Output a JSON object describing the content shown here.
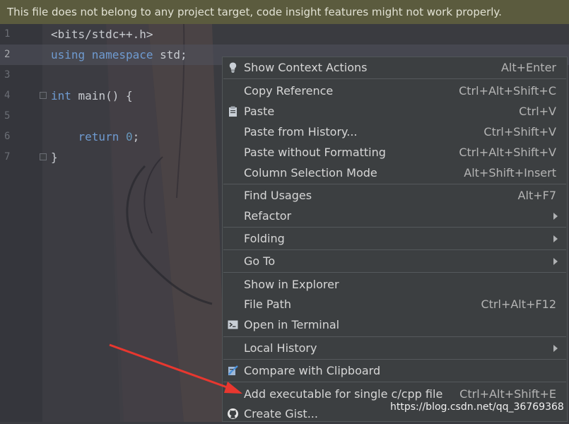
{
  "banner": {
    "text": "This file does not belong to any project target, code insight features might not work properly."
  },
  "editor": {
    "lines": [
      {
        "num": "1",
        "tokens": [
          {
            "t": "<bits/stdc++.h>",
            "c": "plain"
          }
        ]
      },
      {
        "num": "2",
        "tokens": [
          {
            "t": "using namespace",
            "c": "kw"
          },
          {
            "t": " std;",
            "c": "plain"
          }
        ]
      },
      {
        "num": "3",
        "tokens": []
      },
      {
        "num": "4",
        "tokens": [
          {
            "t": "int",
            "c": "kw"
          },
          {
            "t": " main() {",
            "c": "plain"
          }
        ]
      },
      {
        "num": "5",
        "tokens": []
      },
      {
        "num": "6",
        "tokens": [
          {
            "t": "    return",
            "c": "kw"
          },
          {
            "t": " ",
            "c": "plain"
          },
          {
            "t": "0",
            "c": "num"
          },
          {
            "t": ";",
            "c": "plain"
          }
        ]
      },
      {
        "num": "7",
        "tokens": [
          {
            "t": "}",
            "c": "plain"
          }
        ]
      }
    ],
    "current_line": "2"
  },
  "menu": {
    "items": [
      {
        "label": "Show Context Actions",
        "shortcut": "Alt+Enter",
        "icon": "bulb-icon"
      },
      {
        "label": "Copy Reference",
        "shortcut": "Ctrl+Alt+Shift+C"
      },
      {
        "label": "Paste",
        "shortcut": "Ctrl+V",
        "icon": "clipboard-icon"
      },
      {
        "label": "Paste from History...",
        "shortcut": "Ctrl+Shift+V"
      },
      {
        "label": "Paste without Formatting",
        "shortcut": "Ctrl+Alt+Shift+V"
      },
      {
        "label": "Column Selection Mode",
        "shortcut": "Alt+Shift+Insert"
      },
      {
        "label": "Find Usages",
        "shortcut": "Alt+F7"
      },
      {
        "label": "Refactor",
        "submenu": true
      },
      {
        "label": "Folding",
        "submenu": true
      },
      {
        "label": "Go To",
        "submenu": true
      },
      {
        "label": "Show in Explorer",
        "shortcut": ""
      },
      {
        "label": "File Path",
        "shortcut": "Ctrl+Alt+F12"
      },
      {
        "label": "Open in Terminal",
        "shortcut": "",
        "icon": "terminal-icon"
      },
      {
        "label": "Local History",
        "submenu": true
      },
      {
        "label": "Compare with Clipboard",
        "shortcut": "",
        "icon": "compare-icon"
      },
      {
        "label": "Add executable for single c/cpp file",
        "shortcut": "Ctrl+Alt+Shift+E"
      },
      {
        "label": "Create Gist...",
        "shortcut": "",
        "icon": "github-icon"
      }
    ]
  },
  "watermark": {
    "text": "https://blog.csdn.net/qq_36769368"
  },
  "colors": {
    "banner_bg": "#5b5b3e",
    "menu_bg": "#3c3f41",
    "keyword": "#6f9bd1",
    "annotation_arrow": "#e8372f"
  }
}
